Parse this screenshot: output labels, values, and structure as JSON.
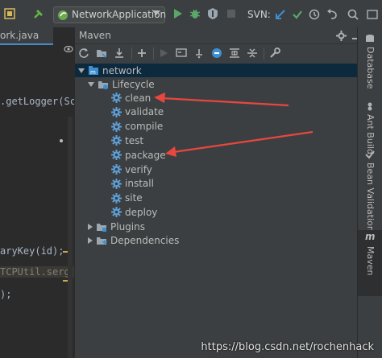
{
  "toolbar": {
    "run_config": "NetworkApplication",
    "svn_label": "SVN:"
  },
  "editor": {
    "tab_label": "ork.java",
    "code_lines": [
      ".getLogger(Sc",
      "aryKey(id);",
      "TCPUtil.serg",
      ");"
    ]
  },
  "maven": {
    "title": "Maven",
    "tree": {
      "root": "network",
      "lifecycle_label": "Lifecycle",
      "lifecycle": [
        "clean",
        "validate",
        "compile",
        "test",
        "package",
        "verify",
        "install",
        "site",
        "deploy"
      ],
      "plugins_label": "Plugins",
      "dependencies_label": "Dependencies"
    }
  },
  "right_strip": {
    "tabs": [
      "Database",
      "Ant Build",
      "Bean Validation",
      "Maven"
    ]
  },
  "watermark": "https://blog.csdn.net/rochenhack",
  "colors": {
    "accent_arrow": "#e8473f",
    "tree_selection": "#0d293e",
    "gear": "#5e9fd7"
  }
}
